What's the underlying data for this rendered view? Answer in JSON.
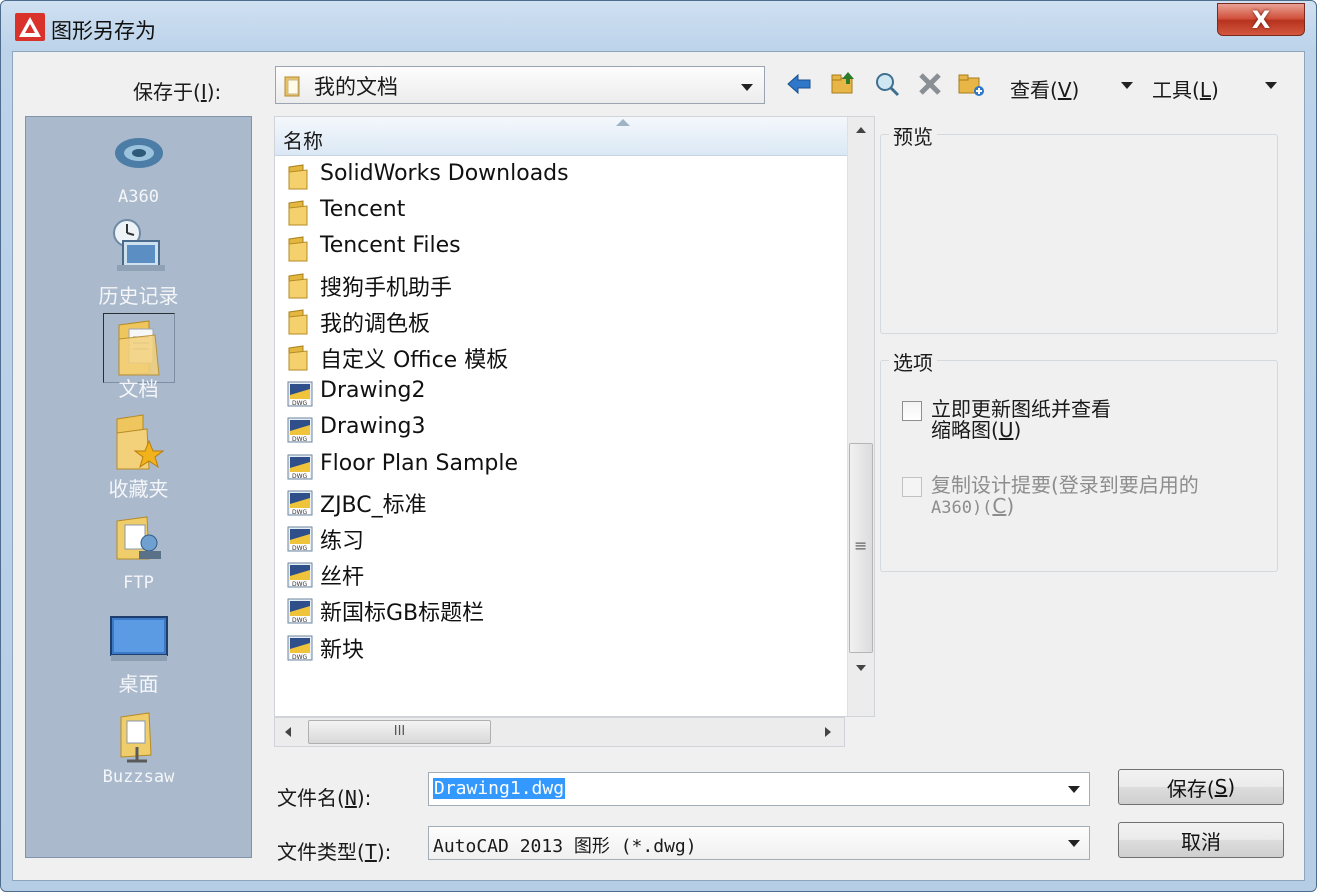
{
  "window": {
    "title": "图形另存为",
    "close_label": "X"
  },
  "savein": {
    "label_pre": "保存于(",
    "label_key": "I",
    "label_post": "):",
    "value": "我的文档"
  },
  "toolbar": {
    "view_pre": "查看(",
    "view_key": "V",
    "view_post": ")",
    "tools_pre": "工具(",
    "tools_key": "L",
    "tools_post": ")",
    "icons": [
      "back-arrow-icon",
      "up-folder-icon",
      "search-web-icon",
      "delete-icon",
      "new-folder-icon"
    ]
  },
  "places": [
    {
      "label": "A360",
      "icon": "a360-icon"
    },
    {
      "label": "历史记录",
      "icon": "history-icon"
    },
    {
      "label": "文档",
      "icon": "documents-folder-icon",
      "selected": true
    },
    {
      "label": "收藏夹",
      "icon": "favorites-icon"
    },
    {
      "label": "FTP",
      "icon": "ftp-icon"
    },
    {
      "label": "桌面",
      "icon": "desktop-icon"
    },
    {
      "label": "Buzzsaw",
      "icon": "buzzsaw-icon"
    }
  ],
  "filelist": {
    "column_name": "名称",
    "items": [
      {
        "name": "SolidWorks Downloads",
        "type": "folder"
      },
      {
        "name": "Tencent",
        "type": "folder"
      },
      {
        "name": "Tencent Files",
        "type": "folder"
      },
      {
        "name": "搜狗手机助手",
        "type": "folder"
      },
      {
        "name": "我的调色板",
        "type": "folder"
      },
      {
        "name": "自定义 Office 模板",
        "type": "folder"
      },
      {
        "name": "Drawing2",
        "type": "dwg"
      },
      {
        "name": "Drawing3",
        "type": "dwg"
      },
      {
        "name": "Floor Plan Sample",
        "type": "dwg"
      },
      {
        "name": "ZJBC_标准",
        "type": "dwg"
      },
      {
        "name": "练习",
        "type": "dwg"
      },
      {
        "name": "丝杆",
        "type": "dwg"
      },
      {
        "name": "新国标GB标题栏",
        "type": "dwg"
      },
      {
        "name": "新块",
        "type": "dwg"
      }
    ],
    "hscroll_grip": "III",
    "vscroll_grip": "≡"
  },
  "preview": {
    "title": "预览"
  },
  "options": {
    "title": "选项",
    "opt1_line1": "立即更新图纸并查看",
    "opt1_line2_pre": "缩略图(",
    "opt1_line2_key": "U",
    "opt1_line2_post": ")",
    "opt1_checked": false,
    "opt2_line1": "复制设计提要(登录到要启用的",
    "opt2_line2_pre": "A360)(",
    "opt2_line2_key": "C",
    "opt2_line2_post": ")",
    "opt2_checked": false,
    "opt2_enabled": false
  },
  "filename": {
    "label_pre": "文件名(",
    "label_key": "N",
    "label_post": "):",
    "value": "Drawing1.dwg"
  },
  "filetype": {
    "label_pre": "文件类型(",
    "label_key": "T",
    "label_post": "):",
    "value": "AutoCAD 2013 图形 (*.dwg)"
  },
  "buttons": {
    "save_pre": "保存(",
    "save_key": "S",
    "save_post": ")",
    "cancel": "取消"
  },
  "colors": {
    "accent_selection": "#3399ff",
    "places_bg": "#aab9cc",
    "close_red": "#c94431"
  }
}
